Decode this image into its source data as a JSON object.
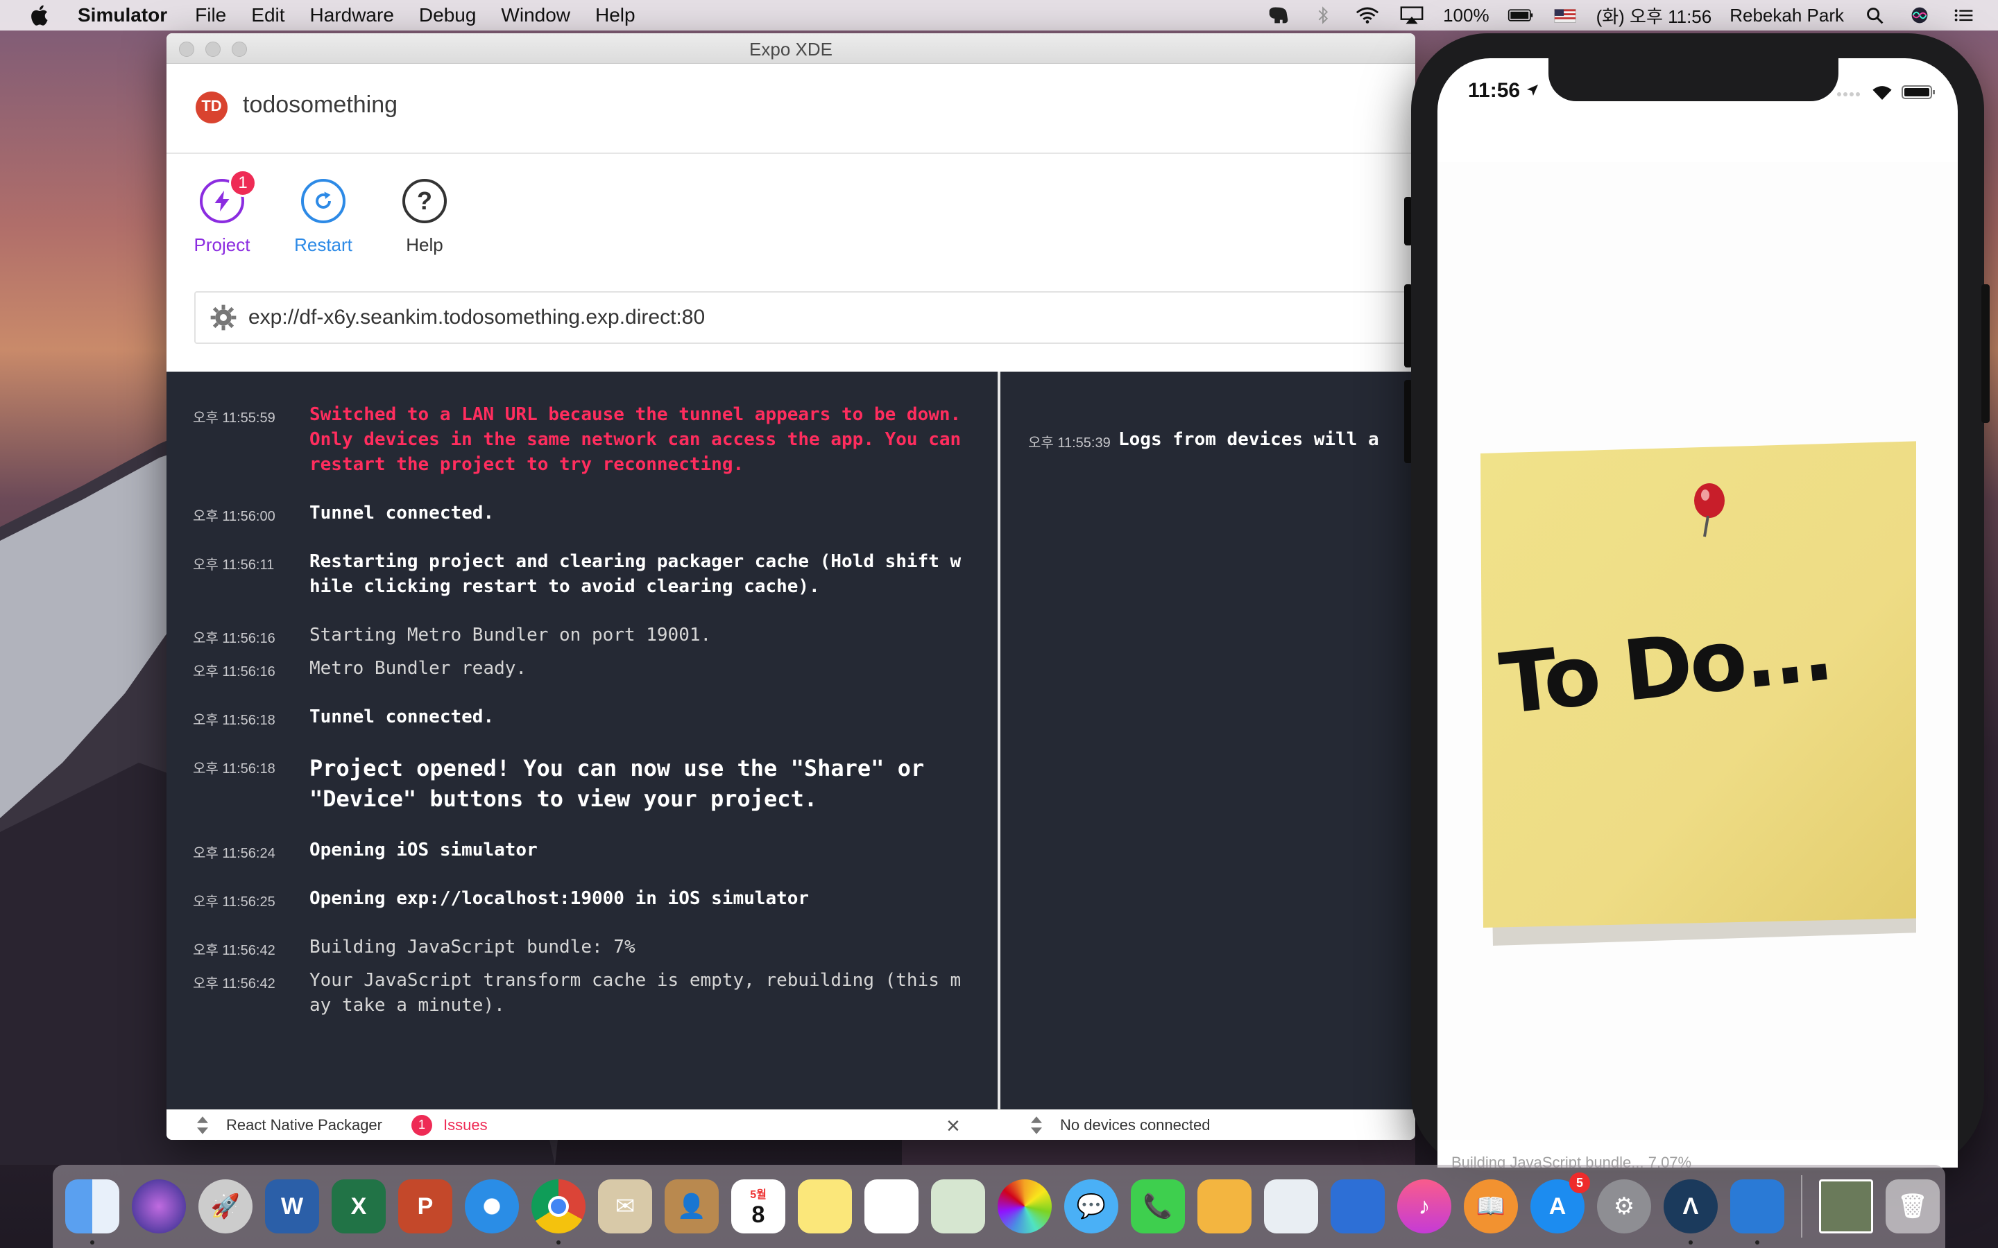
{
  "menubar": {
    "app_name": "Simulator",
    "items": [
      "File",
      "Edit",
      "Hardware",
      "Debug",
      "Window",
      "Help"
    ],
    "battery": "100%",
    "clock": "(화) 오후 11:56",
    "user": "Rebekah Park"
  },
  "xde": {
    "window_title": "Expo XDE",
    "project_initials": "TD",
    "project_name": "todosomething",
    "toolbar": {
      "project_label": "Project",
      "project_badge": "1",
      "restart_label": "Restart",
      "help_label": "Help"
    },
    "url": "exp://df-x6y.seankim.todosomething.exp.direct:80",
    "colors": {
      "accent_purple": "#8b2ce0",
      "accent_blue": "#2d8ae6",
      "error_red": "#ff2d5e",
      "log_bg": "#252934"
    },
    "logs_left": [
      {
        "ts": "오후 11:55:59",
        "msg": "Switched to a LAN URL because the tunnel appears to be down. Only devices in the same network can access the app. You can restart the project to try reconnecting."
      },
      {
        "ts": "오후 11:56:00",
        "msg": "Tunnel connected."
      },
      {
        "ts": "오후 11:56:11",
        "msg": "Restarting project and clearing packager cache (Hold shift while clicking restart to avoid clearing cache)."
      },
      {
        "ts": "오후 11:56:16",
        "msg": "Starting Metro Bundler on port 19001."
      },
      {
        "ts": "오후 11:56:16",
        "msg": "Metro Bundler ready."
      },
      {
        "ts": "오후 11:56:18",
        "msg": "Tunnel connected."
      },
      {
        "ts": "오후 11:56:18",
        "msg": "Project opened! You can now use the \"Share\" or \"Device\" buttons to view your project."
      },
      {
        "ts": "오후 11:56:24",
        "msg": "Opening iOS simulator"
      },
      {
        "ts": "오후 11:56:25",
        "msg": "Opening exp://localhost:19000 in iOS simulator"
      },
      {
        "ts": "오후 11:56:42",
        "msg": "Building JavaScript bundle: 7%"
      },
      {
        "ts": "오후 11:56:42",
        "msg": "Your JavaScript transform cache is empty, rebuilding (this may take a minute)."
      }
    ],
    "logs_right": [
      {
        "ts": "오후 11:55:39",
        "msg": "Logs from devices will a"
      }
    ],
    "footer": {
      "packager_label": "React Native Packager",
      "issues_count": "1",
      "issues_label": "Issues",
      "devices_label": "No devices connected"
    }
  },
  "iphone": {
    "status_time": "11:56",
    "sticky_text": "To Do...",
    "bundle_text": "Building JavaScript bundle... 7.07%"
  },
  "dock": {
    "calendar_month": "5월",
    "calendar_day": "8",
    "appstore_badge": "5"
  }
}
